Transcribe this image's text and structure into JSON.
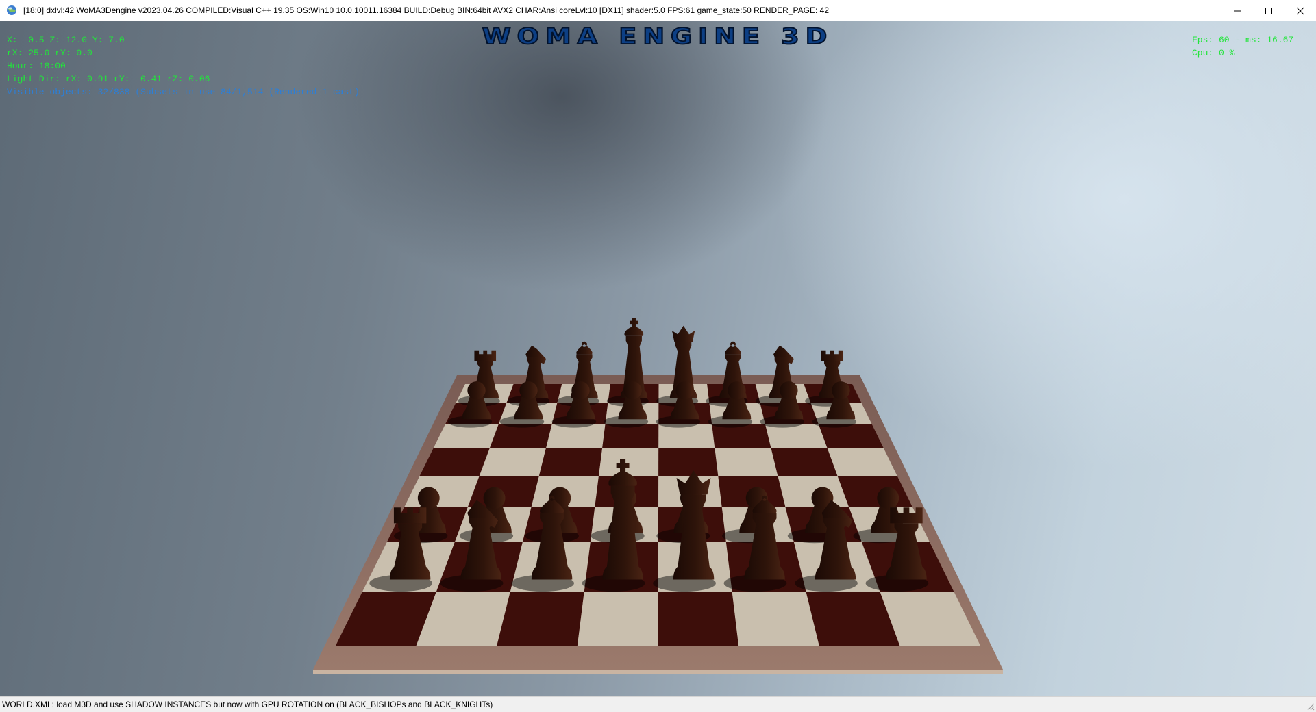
{
  "window": {
    "title": "[18:0] dxlvl:42 WoMA3Dengine v2023.04.26 COMPILED:Visual C++ 19.35 OS:Win10 10.0.10011.16384 BUILD:Debug BIN:64bit AVX2 CHAR:Ansi coreLvl:10 [DX11] shader:5.0 FPS:61 game_state:50 RENDER_PAGE: 42",
    "icon": "globe-icon",
    "controls": [
      "minimize-icon",
      "maximize-icon",
      "close-icon"
    ]
  },
  "logo": {
    "text": "WOMA ENGINE 3D"
  },
  "hud": {
    "left": [
      "X: -0.5 Z:-12.0 Y: 7.0",
      "rX: 25.0 rY: 0.0",
      "Hour: 18:00",
      "Light Dir: rX: 0.91 rY: -0.41 rZ: 0.06"
    ],
    "left_blue": "Visible objects: 32/838 (Subsets in use 84/1,514 (Rendered 1 cast)",
    "right": [
      "Fps: 60 - ms: 16.67",
      "Cpu: 0 %"
    ]
  },
  "colors": {
    "hud_green": "#22e53b",
    "hud_blue": "#2d7fd6",
    "dark_square": "#3d0e0a",
    "light_square": "#c9bfae",
    "board_frame": "#86645a",
    "piece": "#2a120a"
  },
  "board": {
    "rows": 8,
    "cols": 8,
    "back_row_far": [
      "rook",
      "knight",
      "bishop",
      "king",
      "queen",
      "bishop",
      "knight",
      "rook"
    ],
    "front_row_near": [
      "rook",
      "knight",
      "bishop",
      "king",
      "queen",
      "bishop",
      "knight",
      "rook"
    ]
  },
  "statusbar": {
    "text": "WORLD.XML: load M3D and use SHADOW INSTANCES but now with GPU ROTATION on (BLACK_BISHOPs and BLACK_KNIGHTs)"
  }
}
